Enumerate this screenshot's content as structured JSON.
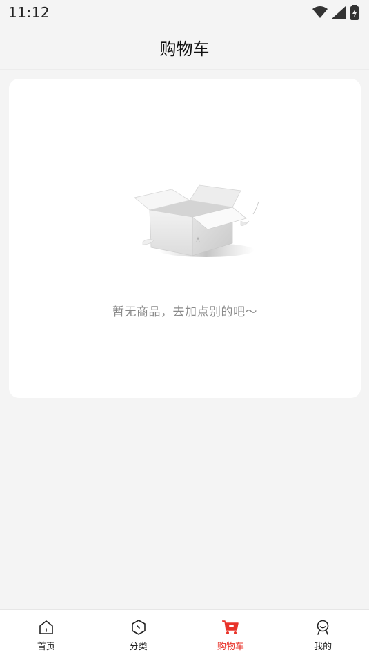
{
  "status_bar": {
    "time": "11:12"
  },
  "header": {
    "title": "购物车"
  },
  "cart": {
    "empty_message": "暂无商品，去加点别的吧～"
  },
  "tabbar": {
    "active_color": "#e8332a",
    "items": [
      {
        "label": "首页",
        "icon": "home-icon",
        "active": false
      },
      {
        "label": "分类",
        "icon": "category-icon",
        "active": false
      },
      {
        "label": "购物车",
        "icon": "cart-icon",
        "active": true
      },
      {
        "label": "我的",
        "icon": "profile-icon",
        "active": false
      }
    ]
  }
}
